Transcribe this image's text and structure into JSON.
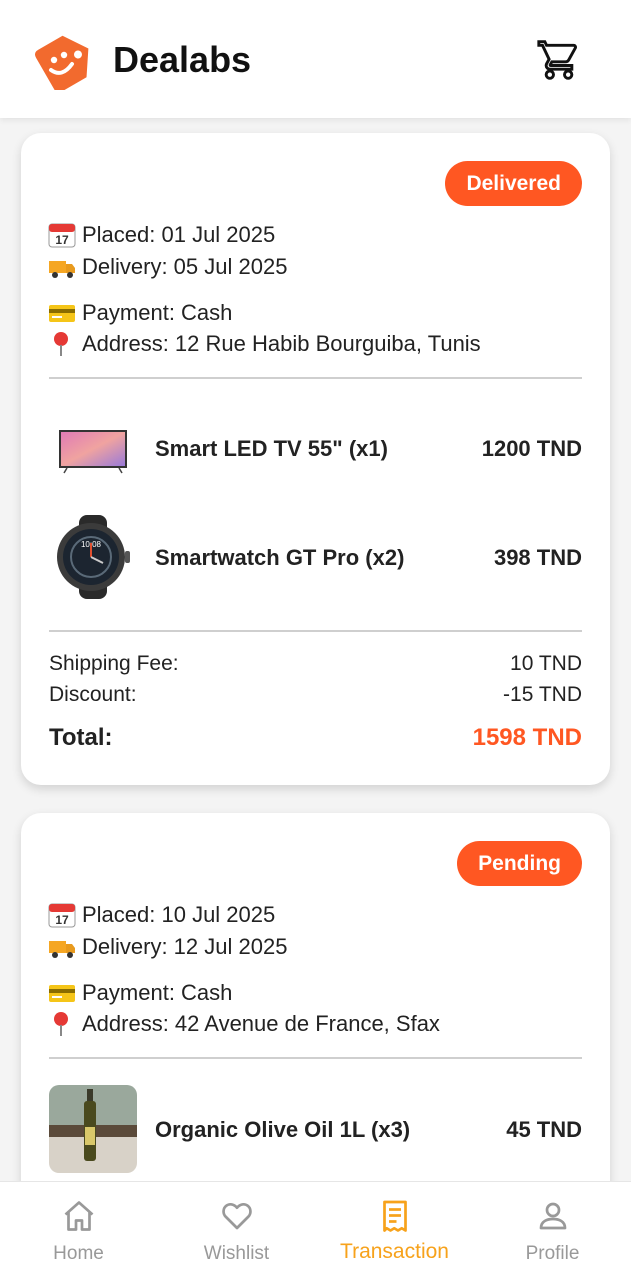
{
  "app": {
    "title": "Dealabs"
  },
  "orders": [
    {
      "status": "Delivered",
      "placed": "Placed: 01 Jul 2025",
      "delivery": "Delivery: 05 Jul 2025",
      "payment": "Payment: Cash",
      "address": "Address: 12 Rue Habib Bourguiba, Tunis",
      "items": [
        {
          "name": "Smart LED TV 55\" (x1)",
          "price": "1200 TND",
          "image": "tv-image"
        },
        {
          "name": "Smartwatch GT Pro (x2)",
          "price": "398 TND",
          "image": "smartwatch-image"
        }
      ],
      "shipping_label": "Shipping Fee:",
      "shipping": "10 TND",
      "discount_label": "Discount:",
      "discount": "-15 TND",
      "total_label": "Total:",
      "total": "1598 TND"
    },
    {
      "status": "Pending",
      "placed": "Placed: 10 Jul 2025",
      "delivery": "Delivery: 12 Jul 2025",
      "payment": "Payment: Cash",
      "address": "Address: 42 Avenue de France, Sfax",
      "items": [
        {
          "name": "Organic Olive Oil 1L (x3)",
          "price": "45 TND",
          "image": "olive-oil-image"
        }
      ]
    }
  ],
  "nav": [
    {
      "label": "Home",
      "icon": "home-icon",
      "active": false
    },
    {
      "label": "Wishlist",
      "icon": "heart-icon",
      "active": false
    },
    {
      "label": "Transaction",
      "icon": "receipt-icon",
      "active": true
    },
    {
      "label": "Profile",
      "icon": "person-icon",
      "active": false
    }
  ],
  "colors": {
    "accent": "#ff5722",
    "active_nav": "#f7a21b",
    "inactive_nav": "#999999"
  }
}
